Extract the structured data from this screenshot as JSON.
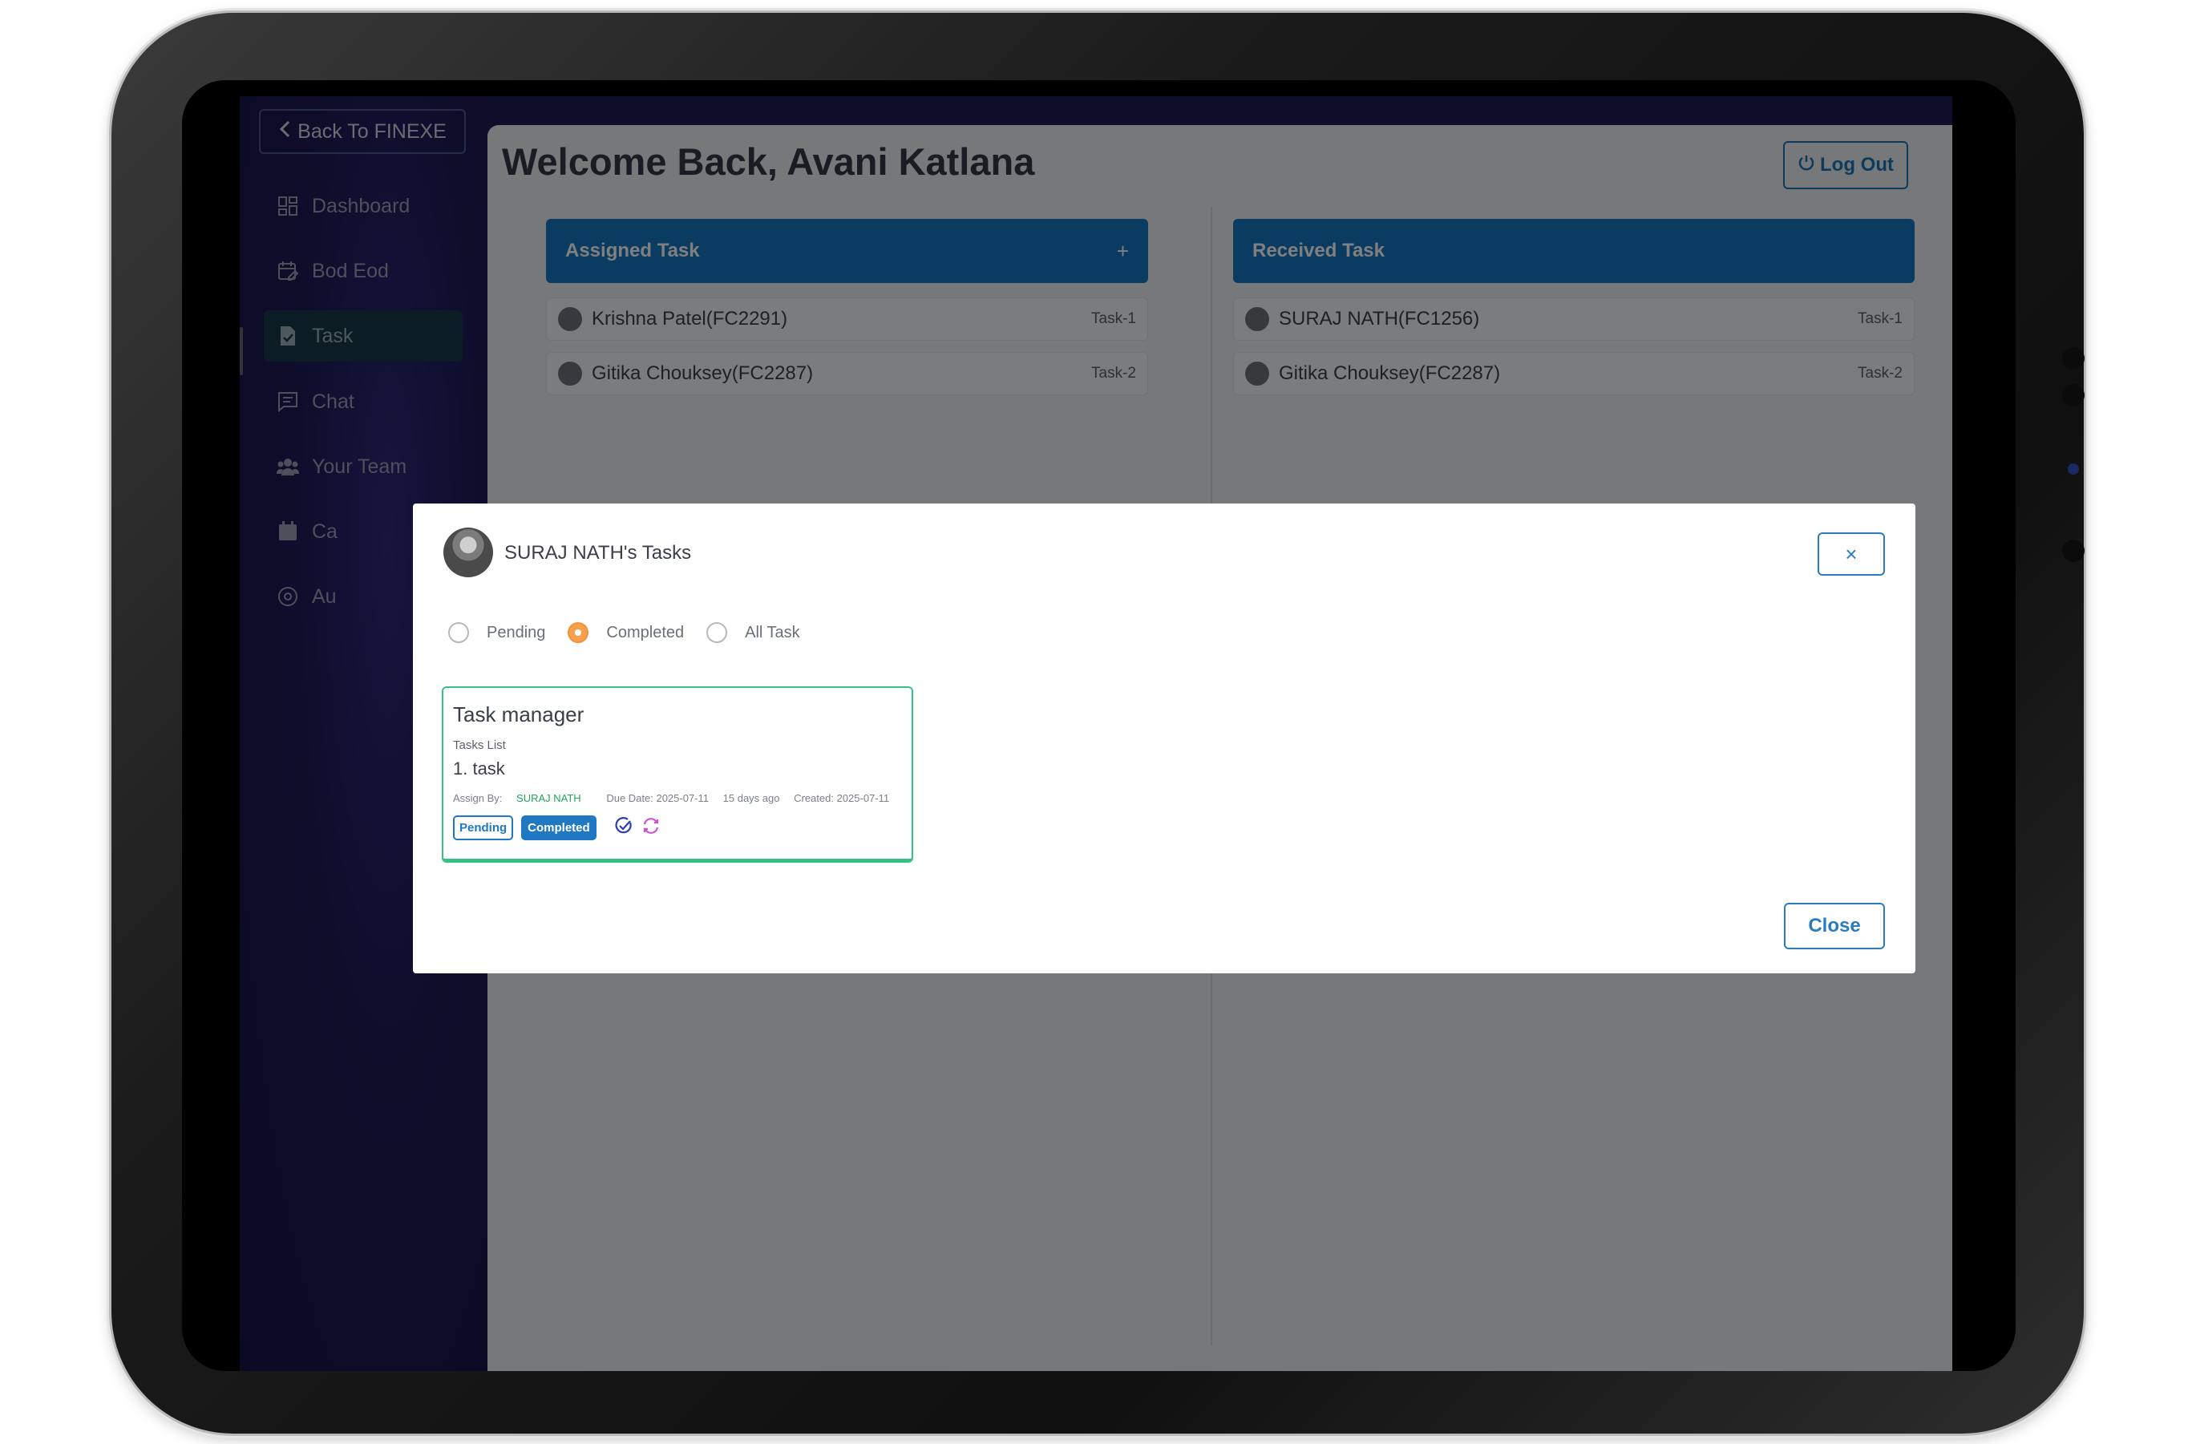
{
  "sidebar": {
    "back_label": "Back To FINEXE",
    "items": [
      {
        "label": "Dashboard"
      },
      {
        "label": "Bod Eod"
      },
      {
        "label": "Task"
      },
      {
        "label": "Chat"
      },
      {
        "label": "Your Team"
      },
      {
        "label": "Ca"
      },
      {
        "label": "Au"
      }
    ],
    "active_index": 2
  },
  "header": {
    "welcome": "Welcome Back, Avani Katlana",
    "logout_label": "Log Out"
  },
  "assigned": {
    "title": "Assigned Task",
    "add_symbol": "+",
    "rows": [
      {
        "name": "Krishna Patel(FC2291)",
        "tag": "Task-1"
      },
      {
        "name": "Gitika Chouksey(FC2287)",
        "tag": "Task-2"
      }
    ]
  },
  "received": {
    "title": "Received Task",
    "rows": [
      {
        "name": "SURAJ NATH(FC1256)",
        "tag": "Task-1"
      },
      {
        "name": "Gitika Chouksey(FC2287)",
        "tag": "Task-2"
      }
    ]
  },
  "modal": {
    "title": "SURAJ NATH's Tasks",
    "close_x": "×",
    "filters": [
      {
        "label": "Pending",
        "checked": false
      },
      {
        "label": "Completed",
        "checked": true
      },
      {
        "label": "All Task",
        "checked": false
      }
    ],
    "card": {
      "title": "Task manager",
      "list_label": "Tasks List",
      "item": "1. task",
      "assign_prefix": "Assign By:",
      "assign_by": "SURAJ NATH",
      "due": "Due Date: 2025-07-11",
      "ago": "15 days ago",
      "created": "Created: 2025-07-11",
      "badge_pending": "Pending",
      "badge_completed": "Completed"
    },
    "close_label": "Close"
  },
  "colors": {
    "accent": "#1577c2",
    "card_border": "#36c286",
    "radio_checked": "#f6a04d",
    "assignee": "#21a65a"
  }
}
